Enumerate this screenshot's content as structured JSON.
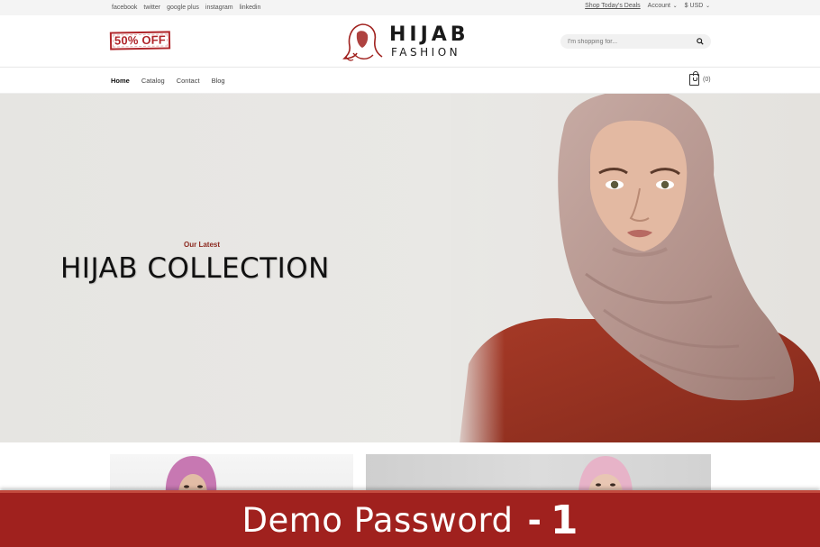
{
  "topbar": {
    "social": [
      "facebook",
      "twitter",
      "google plus",
      "instagram",
      "linkedin"
    ],
    "deals": "Shop Today's Deals",
    "account": "Account",
    "currency": "$ USD"
  },
  "header": {
    "badge": "50% OFF",
    "logo_line1": "HIJAB",
    "logo_line2": "FASHION",
    "search_placeholder": "I'm shopping for..."
  },
  "nav": {
    "links": [
      "Home",
      "Catalog",
      "Contact",
      "Blog"
    ],
    "active": "Home",
    "cart_count": "(0)"
  },
  "hero": {
    "eyebrow": "Our Latest",
    "title": "HIJAB COLLECTION"
  },
  "banner": {
    "text": "Demo Password",
    "dash": "-",
    "number": "1"
  },
  "colors": {
    "accent": "#a0211e",
    "eyebrow": "#8d2a20",
    "hijab": "#b99a93",
    "top": "#9b3322"
  },
  "icons": [
    "search-icon",
    "cart-icon",
    "chevron-down-icon",
    "hijab-logo-icon"
  ]
}
